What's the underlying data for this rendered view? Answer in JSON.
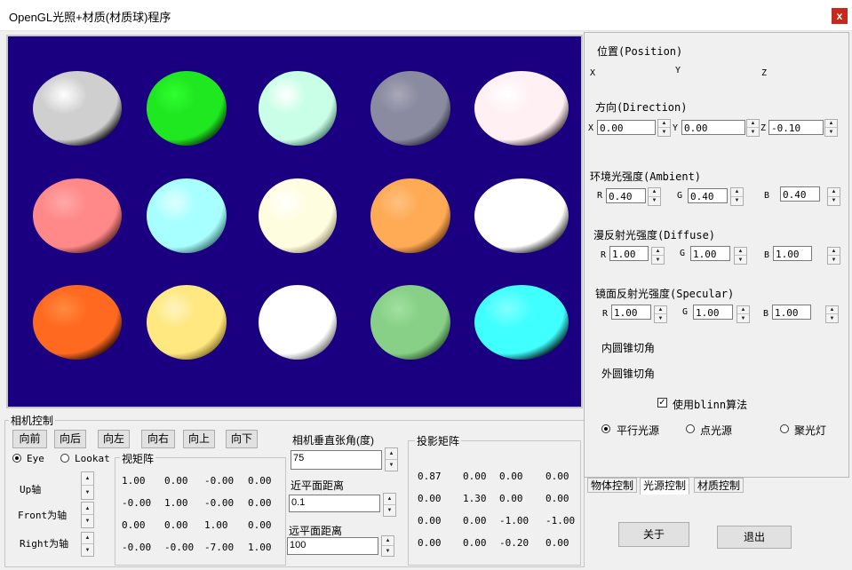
{
  "window": {
    "title": "OpenGL光照+材质(材质球)程序",
    "close_label": "x"
  },
  "spheres": [
    {
      "color": "#cfcfcf",
      "shade": "#0a0a0a",
      "spec": "#ffffff"
    },
    {
      "color": "#20e820",
      "shade": "#0a3a0a",
      "spec": "#30ff30"
    },
    {
      "color": "#c8ffe6",
      "shade": "#4a7a6a",
      "spec": "#ffffff"
    },
    {
      "color": "#8a8aa0",
      "shade": "#2a2a3a",
      "spec": "#a8a8b8"
    },
    {
      "color": "#fff0f4",
      "shade": "#3a2a30",
      "spec": "#ffffff"
    },
    {
      "color": "#ff8888",
      "shade": "#5a2020",
      "spec": "#ffa8a8"
    },
    {
      "color": "#a8ffff",
      "shade": "#3a7070",
      "spec": "#e0ffff"
    },
    {
      "color": "#fffde0",
      "shade": "#9a9070",
      "spec": "#ffffff"
    },
    {
      "color": "#ffaa55",
      "shade": "#6a3a10",
      "spec": "#ffc080"
    },
    {
      "color": "#ffffff",
      "shade": "#202020",
      "spec": "#ffffff"
    },
    {
      "color": "#ff6a20",
      "shade": "#2a0a00",
      "spec": "#ff8a40"
    },
    {
      "color": "#ffe880",
      "shade": "#8a7020",
      "spec": "#fff4c0"
    },
    {
      "color": "#ffffff",
      "shade": "#707070",
      "spec": "#ffffff"
    },
    {
      "color": "#88d088",
      "shade": "#2a5a2a",
      "spec": "#a0e0a0"
    },
    {
      "color": "#40ffff",
      "shade": "#001010",
      "spec": "#80ffff"
    }
  ],
  "camera": {
    "group_label": "相机控制",
    "buttons": [
      "向前",
      "向后",
      "向左",
      "向右",
      "向上",
      "向下"
    ],
    "eye_label": "Eye",
    "lookat_label": "Lookat",
    "up_axis": "Up轴",
    "front_axis": "Front为轴",
    "right_axis": "Right为轴",
    "view_matrix_label": "视矩阵",
    "view_matrix": [
      [
        "1.00",
        "0.00",
        "-0.00",
        "0.00"
      ],
      [
        "-0.00",
        "1.00",
        "-0.00",
        "0.00"
      ],
      [
        "0.00",
        "0.00",
        "1.00",
        "0.00"
      ],
      [
        "-0.00",
        "-0.00",
        "-7.00",
        "1.00"
      ]
    ],
    "fov_label": "相机垂直张角(度)",
    "fov_value": "75",
    "near_label": "近平面距离",
    "near_value": "0.1",
    "far_label": "远平面距离",
    "far_value": "100",
    "proj_matrix_label": "投影矩阵",
    "proj_matrix": [
      [
        "0.87",
        "0.00",
        "0.00",
        "0.00"
      ],
      [
        "0.00",
        "1.30",
        "0.00",
        "0.00"
      ],
      [
        "0.00",
        "0.00",
        "-1.00",
        "-1.00"
      ],
      [
        "0.00",
        "0.00",
        "-0.20",
        "0.00"
      ]
    ]
  },
  "light": {
    "position_label": "位置(Position)",
    "x": "X",
    "y": "Y",
    "z": "Z",
    "direction_label": "方向(Direction)",
    "dir_x": "0.00",
    "dir_y": "0.00",
    "dir_z": "-0.10",
    "ambient_label": "环境光强度(Ambient)",
    "amb_r": "0.40",
    "amb_g": "0.40",
    "amb_b": "0.40",
    "diffuse_label": "漫反射光强度(Diffuse)",
    "dif_r": "1.00",
    "dif_g": "1.00",
    "dif_b": "1.00",
    "specular_label": "镜面反射光强度(Specular)",
    "spec_r": "1.00",
    "spec_g": "1.00",
    "spec_b": "1.00",
    "r": "R",
    "g": "G",
    "b": "B",
    "inner_cone": "内圆锥切角",
    "outer_cone": "外圆锥切角",
    "blinn_label": "使用blinn算法",
    "directional": "平行光源",
    "point": "点光源",
    "spot": "聚光灯"
  },
  "tabs": [
    "物体控制",
    "光源控制",
    "材质控制"
  ],
  "about_label": "关于",
  "exit_label": "退出"
}
